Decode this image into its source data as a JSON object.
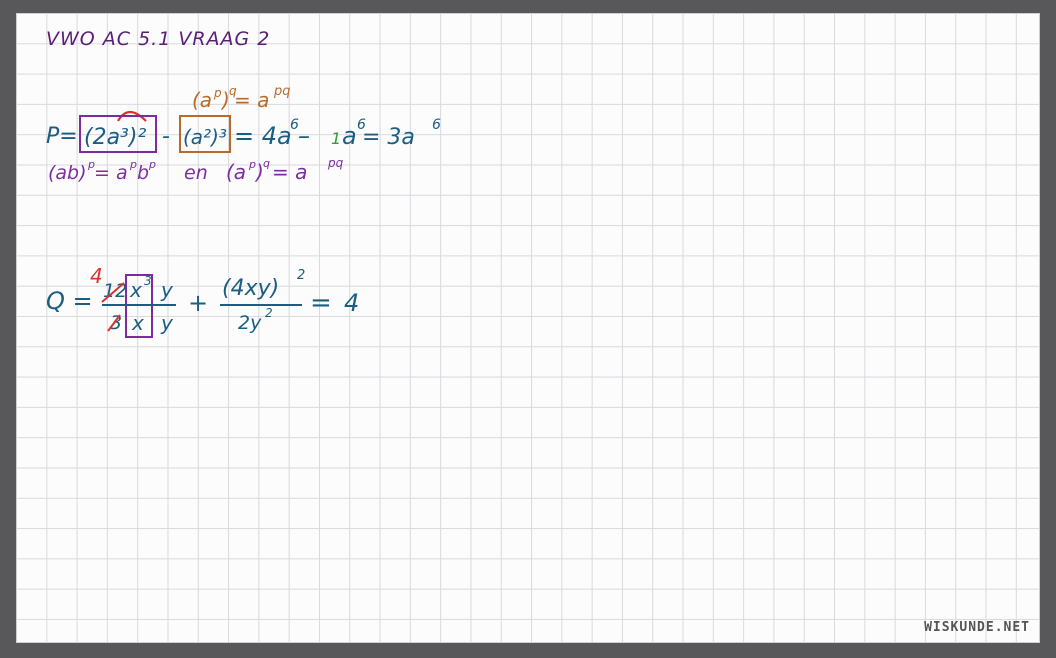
{
  "colors": {
    "teal": "#1b5e82",
    "purple": "#7a2da1",
    "brown": "#b86a2a",
    "red": "#d9342b",
    "green": "#2f9e3a",
    "title": "#5a1e78"
  },
  "title": "VWO AC 5.1 VRAAG 2",
  "p_line": {
    "lhs": "P=",
    "term1": "(2a³)²",
    "minus": "-",
    "term2": "(a²)³",
    "rest_a": "= 4a",
    "exp6a": "6",
    "rest_b": " –",
    "one": "1",
    "rest_c": "a",
    "exp6b": "6",
    "rest_d": " = 3a",
    "exp6c": "6"
  },
  "rule_top": {
    "base": "(a",
    "p": "p",
    "close": ")",
    "q": "q",
    "eq": " = a",
    "pq": "pq"
  },
  "rule_bottom": {
    "part1_base": "(ab)",
    "part1_p": "p",
    "part1_eq": " = a",
    "part1_p2": "p",
    "part1_b": "b",
    "part1_p3": "p",
    "en": "en",
    "part2_base": "(a",
    "part2_p": "p",
    "part2_close": ")",
    "part2_q": "q",
    "part2_eq": " = a",
    "part2_pq": "pq"
  },
  "q_line": {
    "lhs": "Q =",
    "num_coef": "12",
    "num_x": "x",
    "num_x_exp": "3",
    "num_y": "y",
    "den_coef": "3",
    "den_x": "x",
    "den_y": "y",
    "reduced": "4",
    "plus": "+",
    "frac2_num": "(4xy)",
    "frac2_num_exp": "2",
    "frac2_den": "2y",
    "frac2_den_exp": "2",
    "eq": "=",
    "rhs": "4"
  },
  "watermark": "WISKUNDE.NET"
}
